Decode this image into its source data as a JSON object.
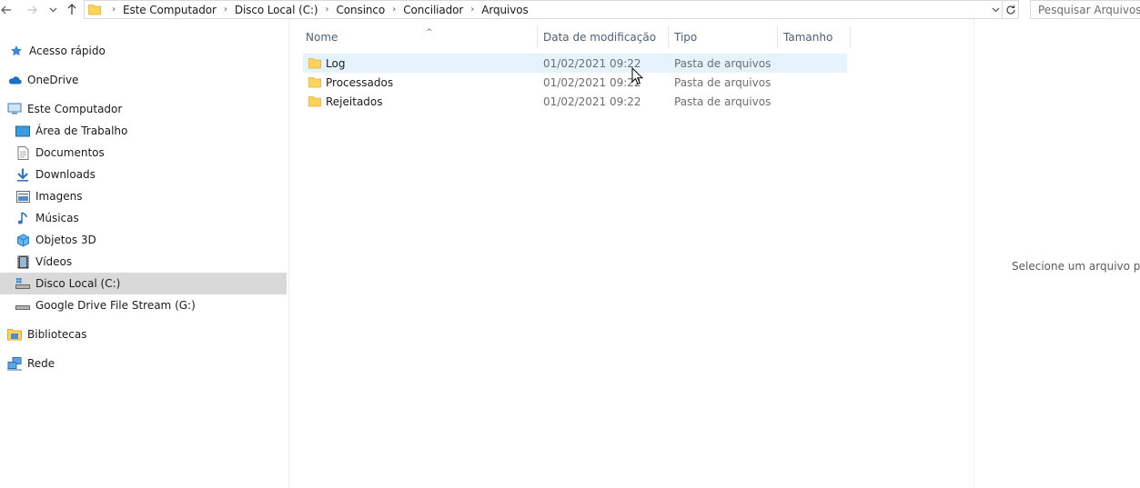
{
  "topbar": {
    "back_icon": "arrow-left-icon",
    "forward_icon": "arrow-right-icon",
    "recent_icon": "chevron-down-icon",
    "up_icon": "arrow-up-icon",
    "breadcrumbs": [
      "Este Computador",
      "Disco Local (C:)",
      "Consinco",
      "Conciliador",
      "Arquivos"
    ],
    "search_placeholder": "Pesquisar Arquivos"
  },
  "sidebar": {
    "items": [
      {
        "label": "Acesso rápido",
        "icon": "star-icon"
      },
      {
        "label": "OneDrive",
        "icon": "cloud-icon"
      },
      {
        "label": "Este Computador",
        "icon": "computer-icon"
      },
      {
        "label": "Área de Trabalho",
        "icon": "desktop-icon"
      },
      {
        "label": "Documentos",
        "icon": "document-icon"
      },
      {
        "label": "Downloads",
        "icon": "download-icon"
      },
      {
        "label": "Imagens",
        "icon": "image-icon"
      },
      {
        "label": "Músicas",
        "icon": "music-icon"
      },
      {
        "label": "Objetos 3D",
        "icon": "cube-icon"
      },
      {
        "label": "Vídeos",
        "icon": "video-icon"
      },
      {
        "label": "Disco Local (C:)",
        "icon": "drive-icon",
        "selected": true
      },
      {
        "label": "Google Drive File Stream (G:)",
        "icon": "drive-icon"
      },
      {
        "label": "Bibliotecas",
        "icon": "library-icon"
      },
      {
        "label": "Rede",
        "icon": "network-icon"
      }
    ]
  },
  "filelist": {
    "columns": {
      "name": "Nome",
      "date": "Data de modificação",
      "type": "Tipo",
      "size": "Tamanho"
    },
    "rows": [
      {
        "name": "Log",
        "date": "01/02/2021 09:22",
        "type": "Pasta de arquivos"
      },
      {
        "name": "Processados",
        "date": "01/02/2021 09:22",
        "type": "Pasta de arquivos"
      },
      {
        "name": "Rejeitados",
        "date": "01/02/2021 09:22",
        "type": "Pasta de arquivos"
      }
    ]
  },
  "preview": {
    "message": "Selecione um arquivo para"
  },
  "colors": {
    "selected": "#d9d9d9",
    "hover": "#e5f3ff",
    "folder": "#ffd35a",
    "header_text": "#4c607a"
  }
}
